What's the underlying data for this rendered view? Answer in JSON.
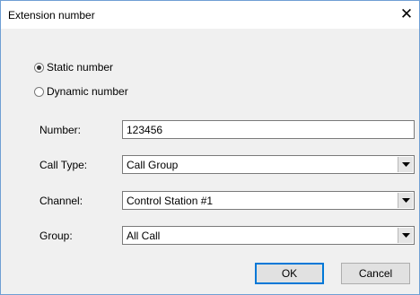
{
  "window": {
    "title": "Extension number"
  },
  "number_mode": {
    "options": [
      {
        "label": "Static number",
        "checked": true
      },
      {
        "label": "Dynamic number",
        "checked": false
      }
    ]
  },
  "fields": {
    "number": {
      "label": "Number:",
      "value": "123456"
    },
    "call_type": {
      "label": "Call Type:",
      "value": "Call Group"
    },
    "channel": {
      "label": "Channel:",
      "value": "Control Station #1"
    },
    "group": {
      "label": "Group:",
      "value": "All Call"
    }
  },
  "buttons": {
    "ok": "OK",
    "cancel": "Cancel"
  },
  "icons": {
    "close": "close-icon",
    "dropdown": "chevron-down-icon"
  },
  "colors": {
    "focus_border": "#0078d7",
    "window_border": "#6f9fd4"
  }
}
